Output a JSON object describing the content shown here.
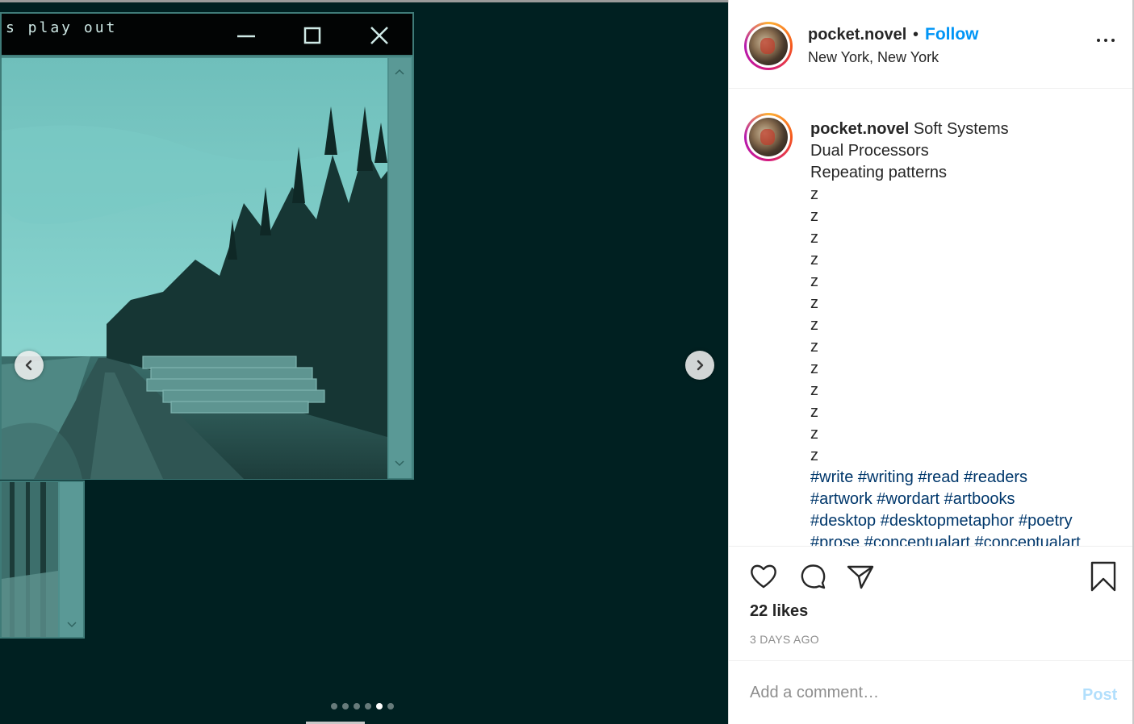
{
  "media": {
    "window_title": "s play out",
    "carousel": {
      "count": 6,
      "active_index": 4
    }
  },
  "post": {
    "username": "pocket.novel",
    "bullet": "•",
    "follow_label": "Follow",
    "location": "New York, New York",
    "caption": {
      "username": "pocket.novel",
      "first_line": "Soft Systems",
      "lines": [
        "Dual Processors",
        "Repeating patterns",
        "z",
        "z",
        "z",
        "z",
        "z",
        "z",
        "z",
        "z",
        "z",
        "z",
        "z",
        "z",
        "z"
      ],
      "hashtag_lines": [
        "#write #writing #read #readers",
        "#artwork #wordart #artbooks",
        "#desktop #desktopmetaphor #poetry",
        "#prose #conceptualart #conceptualart"
      ]
    },
    "likes": "22 likes",
    "time_ago": "3 DAYS AGO"
  },
  "comment": {
    "placeholder": "Add a comment…",
    "post_label": "Post"
  },
  "colors": {
    "media_bg": "#002021",
    "follow": "#0095f6",
    "hashtag": "#00376b",
    "post_disabled": "#b2dffc",
    "window_frame": "#4e8f8c"
  },
  "icons": [
    "chevron-left-icon",
    "chevron-right-icon",
    "more-icon",
    "heart-icon",
    "comment-icon",
    "share-icon",
    "bookmark-icon",
    "minimize-icon",
    "maximize-icon",
    "close-icon"
  ]
}
